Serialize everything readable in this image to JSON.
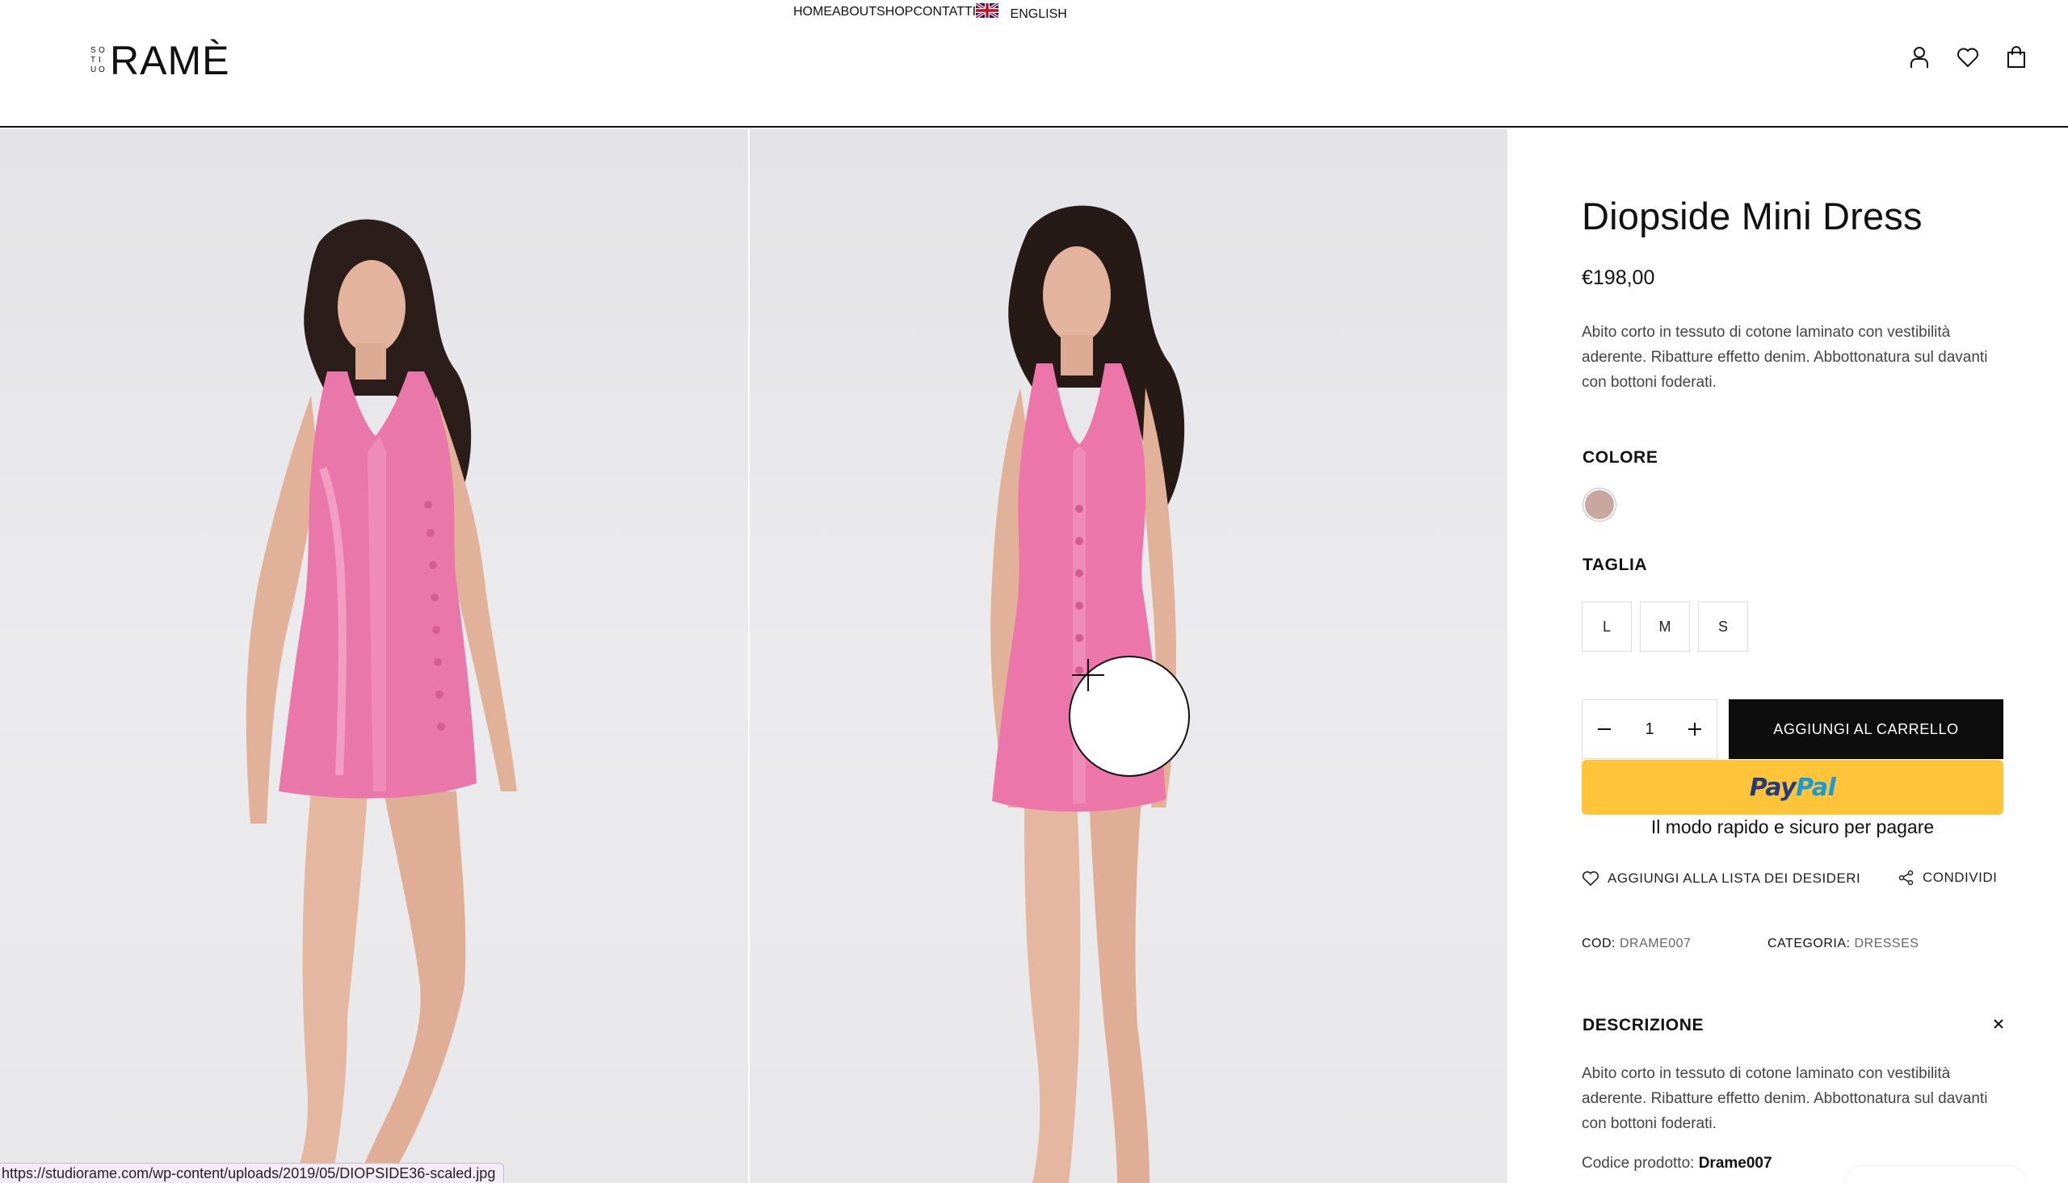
{
  "header": {
    "logo_small": [
      "S",
      "O",
      "T",
      "I",
      "U",
      "O"
    ],
    "logo_main": "RAMÈ",
    "nav": [
      "HOME",
      "ABOUT",
      "SHOP",
      "CONTATTI"
    ],
    "language": "ENGLISH",
    "icons": [
      "account-icon",
      "wishlist-heart-icon",
      "shopping-bag-icon"
    ]
  },
  "gallery": {
    "zoom_icon": "plus-icon",
    "status_url": "https://studiorame.com/wp-content/uploads/2019/05/DIOPSIDE36-scaled.jpg"
  },
  "product": {
    "title": "Diopside Mini Dress",
    "price": "€198,00",
    "short_description": "Abito corto in tessuto di cotone laminato con vestibilità aderente. Ribatture effetto denim. Abbottonatura sul davanti con bottoni foderati.",
    "color_label": "COLORE",
    "color_swatch": "#c9a7a0",
    "size_label": "TAGLIA",
    "sizes": [
      "L",
      "M",
      "S"
    ],
    "quantity": "1",
    "add_to_cart": "AGGIUNGI AL CARRELLO",
    "paypal_pay": "Pay",
    "paypal_pal": "Pal",
    "paypal_tagline": "Il modo rapido e sicuro per pagare",
    "wishlist": "AGGIUNGI ALLA LISTA DEI DESIDERI",
    "share": "CONDIVIDI",
    "sku_label": "COD:",
    "sku_value": "DRAME007",
    "category_label": "CATEGORIA:",
    "category_value": "DRESSES",
    "description_heading": "DESCRIZIONE",
    "description": "Abito corto in tessuto di cotone laminato con vestibilità aderente. Ribatture effetto denim. Abbottonatura sul davanti con bottoni foderati.",
    "product_code_label": "Codice prodotto:",
    "product_code_value": "Drame007"
  }
}
